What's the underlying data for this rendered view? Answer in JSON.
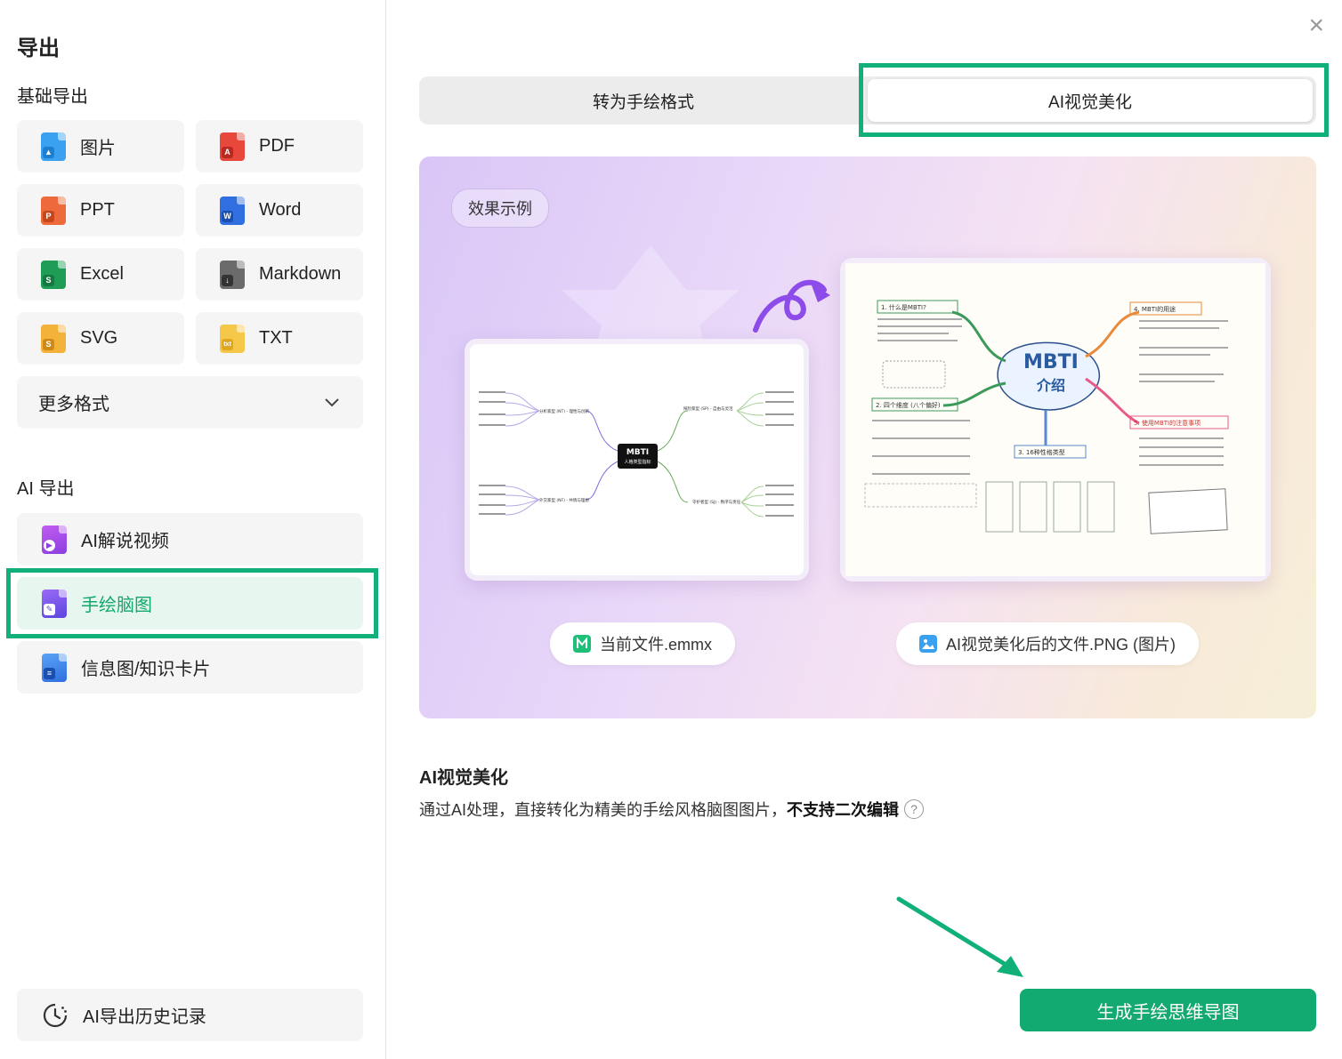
{
  "dialog": {
    "title": "导出",
    "close_icon": "×"
  },
  "basic": {
    "title": "基础导出",
    "formats": [
      {
        "label": "图片",
        "icon": "image-file-icon",
        "color": "#3aa0f0"
      },
      {
        "label": "PDF",
        "icon": "pdf-file-icon",
        "color": "#e8483b"
      },
      {
        "label": "PPT",
        "icon": "ppt-file-icon",
        "color": "#ee6a3c"
      },
      {
        "label": "Word",
        "icon": "word-file-icon",
        "color": "#2f6fe0"
      },
      {
        "label": "Excel",
        "icon": "excel-file-icon",
        "color": "#1f9d57"
      },
      {
        "label": "Markdown",
        "icon": "markdown-file-icon",
        "color": "#555555"
      },
      {
        "label": "SVG",
        "icon": "svg-file-icon",
        "color": "#f3b23a"
      },
      {
        "label": "TXT",
        "icon": "txt-file-icon",
        "color": "#f5c84a"
      }
    ],
    "more": "更多格式"
  },
  "ai": {
    "title": "AI 导出",
    "items": [
      {
        "label": "AI解说视频",
        "icon": "video-file-icon"
      },
      {
        "label": "手绘脑图",
        "icon": "handdrawn-file-icon"
      },
      {
        "label": "信息图/知识卡片",
        "icon": "card-file-icon"
      }
    ],
    "history": "AI导出历史记录"
  },
  "tabs": {
    "left": "转为手绘格式",
    "right": "AI视觉美化"
  },
  "preview": {
    "badge": "效果示例",
    "source_file": "当前文件.emmx",
    "result_file": "AI视觉美化后的文件.PNG (图片)",
    "mm_center_title": "MBTI",
    "mm_center_sub": "人格类型指标",
    "mm_branches": [
      "分析家型 (NT) - 理性与创新",
      "探险家型 (SP) - 自由与灵活",
      "外交家型 (NF) - 共情与理想",
      "守护者型 (SJ) - 秩序与责任"
    ],
    "hd_title_1": "MBTI",
    "hd_title_2": "介绍",
    "hd_branches": [
      "1. 什么是MBTI?",
      "4. MBTI的用途",
      "2. 四个维度 (八个偏好)",
      "3. 16种性格类型",
      "5. 使用MBTI的注意事项"
    ]
  },
  "description": {
    "title": "AI视觉美化",
    "text": "通过AI处理，直接转化为精美的手绘风格脑图图片，",
    "bold": "不支持二次编辑",
    "help": "?"
  },
  "generate_button": "生成手绘思维导图",
  "colors": {
    "accent": "#12aa70",
    "highlight": "#10b078"
  }
}
